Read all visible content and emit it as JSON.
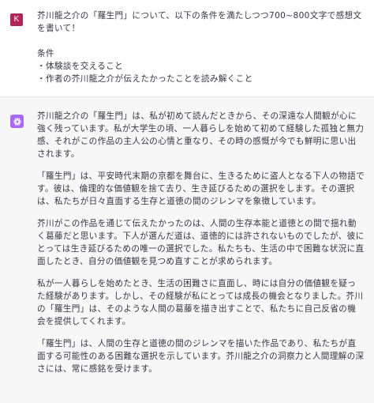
{
  "colors": {
    "user_avatar": "#b32459",
    "bot_avatar": "#ab68ff",
    "bot_bg": "#f7f7f8"
  },
  "user": {
    "avatar_letter": "K",
    "prompt": "芥川龍之介の「羅生門」について、以下の条件を満たしつつ700~800文字で感想文を書いて！",
    "conditions_title": "条件",
    "conditions": [
      "・体験談を交えること",
      "・作者の芥川龍之介が伝えたかったことを読み解くこと"
    ]
  },
  "assistant": {
    "avatar_icon": "openai-logo-icon",
    "paragraphs": [
      "芥川龍之介の「羅生門」は、私が初めて読んだときから、その深遠な人間観が心に強く残っています。私が大学生の頃、一人暮らしを始めて初めて経験した孤独と無力感、それがこの作品の主人公の心情と重なり、その時の感慨が今でも鮮明に思い出されます。",
      "「羅生門」は、平安時代末期の京都を舞台に、生きるために盗人となる下人の物語です。彼は、倫理的な価値観を捨て去り、生き延びるための選択をします。その選択は、私たちが日々直面する生存と道徳の間のジレンマを象徴しています。",
      "芥川がこの作品を通じて伝えたかったのは、人間の生存本能と道徳との間で揺れ動く葛藤だと思います。下人が選んだ道は、道徳的には許されないものでしたが、彼にとっては生き延びるための唯一の選択でした。私たちも、生活の中で困難な状況に直面したとき、自分の価値観を見つめ直すことが求められます。",
      "私が一人暮らしを始めたとき、生活の困難さに直面し、時には自分の価値観を疑った経験があります。しかし、その経験が私にとっては成長の機会となりました。芥川の「羅生門」は、そのような人間の葛藤を描き出すことで、私たちに自己反省の機会を提供してくれます。",
      "「羅生門」は、人間の生存と道徳の間のジレンマを描いた作品であり、私たちが直面する可能性のある困難な選択を示しています。芥川龍之介の洞察力と人間理解の深さには、常に感銘を受けます。"
    ]
  }
}
